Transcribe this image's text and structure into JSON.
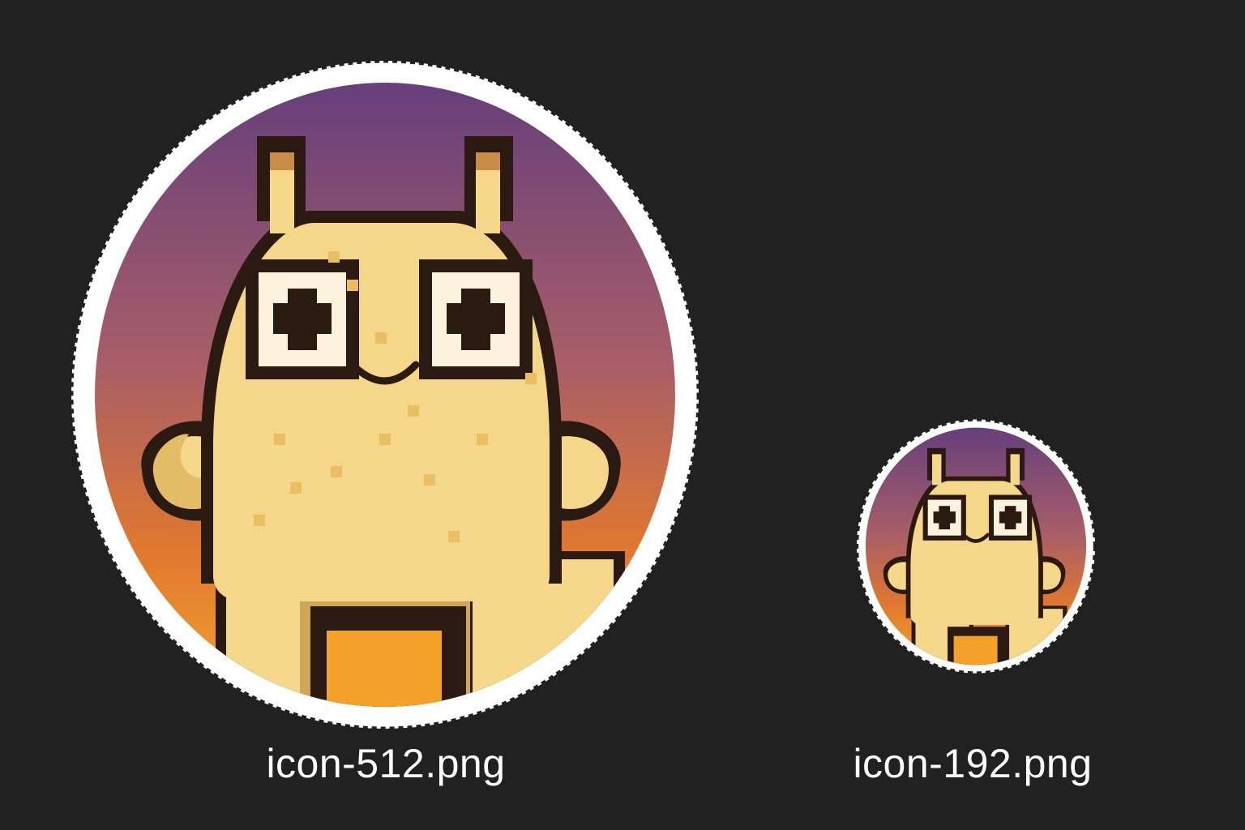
{
  "window": {
    "background": "#212121"
  },
  "files": [
    {
      "filename": "icon-512.png",
      "size_label": "512",
      "selected": true
    },
    {
      "filename": "icon-192.png",
      "size_label": "192",
      "selected": true
    }
  ],
  "icon_art": {
    "subject": "pixel-art yellow slug creature with antennae",
    "gradient_colors": [
      "#663f7b",
      "#a85e68",
      "#e0782f",
      "#f4a631"
    ],
    "body_color": "#f4d78a",
    "outline_color": "#2b1a12",
    "selection_ring_color": "#ffffff"
  }
}
